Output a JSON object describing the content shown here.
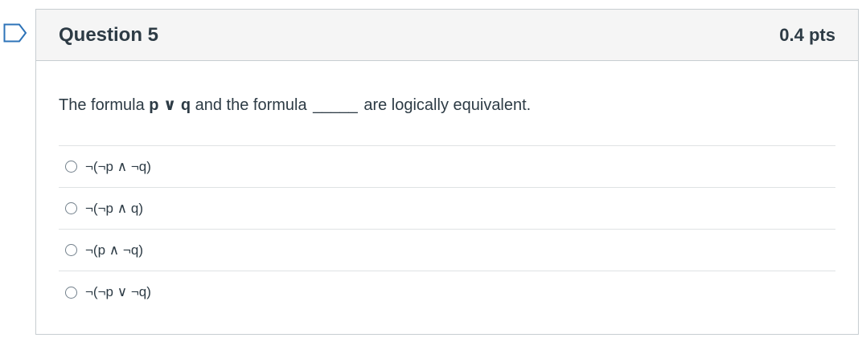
{
  "question": {
    "title": "Question 5",
    "points": "0.4 pts",
    "text_prefix": "The formula ",
    "formula": "p ∨ q",
    "text_middle": " and the formula ",
    "blank": "_____",
    "text_suffix": " are logically equivalent.",
    "answers": [
      {
        "label": "¬(¬p ∧ ¬q)"
      },
      {
        "label": "¬(¬p ∧ q)"
      },
      {
        "label": "¬(p ∧ ¬q)"
      },
      {
        "label": "¬(¬p ∨ ¬q)"
      }
    ]
  },
  "colors": {
    "flag": "#2d73b8",
    "text": "#2d3b45",
    "header_bg": "#f5f5f5",
    "border": "#c7cdd1"
  }
}
